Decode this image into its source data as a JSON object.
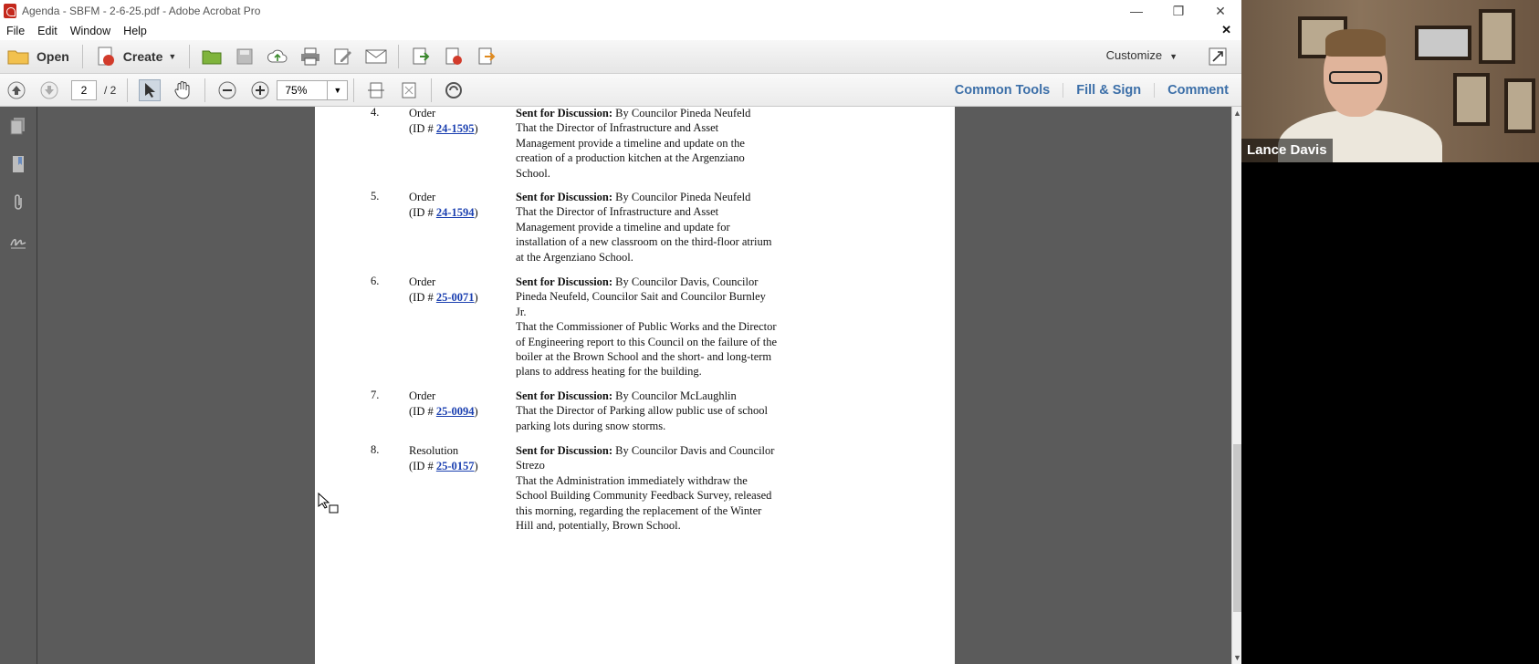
{
  "window": {
    "title": "Agenda - SBFM - 2-6-25.pdf - Adobe Acrobat Pro",
    "controls": {
      "minimize": "—",
      "maximize": "❐",
      "close": "✕"
    }
  },
  "menu": {
    "items": [
      "File",
      "Edit",
      "Window",
      "Help"
    ],
    "close_doc": "✕"
  },
  "toolbar1": {
    "open_label": "Open",
    "create_label": "Create",
    "customize_label": "Customize"
  },
  "toolbar2": {
    "current_page": "2",
    "total_pages": "/ 2",
    "zoom": "75%",
    "panels": [
      "Common Tools",
      "Fill & Sign",
      "Comment"
    ]
  },
  "document": {
    "items": [
      {
        "num": "4.",
        "type": "Order",
        "id_prefix": "(ID # ",
        "id": "24-1595",
        "id_suffix": ")",
        "lead": "Sent for Discussion:",
        "sponsor": " By Councilor Pineda Neufeld",
        "lines": [
          "That the Director of Infrastructure and Asset",
          "Management provide a timeline and update on the",
          "creation of a production kitchen at the Argenziano",
          "School."
        ]
      },
      {
        "num": "5.",
        "type": "Order",
        "id_prefix": "(ID # ",
        "id": "24-1594",
        "id_suffix": ")",
        "lead": "Sent for Discussion:",
        "sponsor": " By Councilor Pineda Neufeld",
        "lines": [
          "That the Director of Infrastructure and Asset",
          "Management provide a timeline and update for",
          "installation of a new classroom on the third-floor atrium",
          "at the Argenziano School."
        ]
      },
      {
        "num": "6.",
        "type": "Order",
        "id_prefix": "(ID # ",
        "id": "25-0071",
        "id_suffix": ")",
        "lead": "Sent for Discussion:",
        "sponsor": " By Councilor Davis, Councilor",
        "lines": [
          "Pineda Neufeld, Councilor Sait and Councilor Burnley",
          "Jr.",
          "That the Commissioner of Public Works and the Director",
          "of Engineering report to this Council on the failure of the",
          "boiler at the Brown School and the short- and long-term",
          "plans to address heating for the building."
        ]
      },
      {
        "num": "7.",
        "type": "Order",
        "id_prefix": "(ID # ",
        "id": "25-0094",
        "id_suffix": ")",
        "lead": "Sent for Discussion:",
        "sponsor": " By Councilor McLaughlin",
        "lines": [
          "That the Director of Parking allow public use of school",
          "parking lots during snow storms."
        ]
      },
      {
        "num": "8.",
        "type": "Resolution",
        "id_prefix": "(ID # ",
        "id": "25-0157",
        "id_suffix": ")",
        "lead": "Sent for Discussion:",
        "sponsor": " By Councilor Davis and Councilor",
        "lines": [
          "Strezo",
          "That the Administration immediately withdraw the",
          "School Building Community Feedback Survey, released",
          "this morning, regarding the replacement of the Winter",
          "Hill and, potentially, Brown School."
        ]
      }
    ]
  },
  "webcam": {
    "participant_name": "Lance Davis"
  },
  "colors": {
    "accent_link": "#3c6fa8",
    "doc_link": "#1a3fb0",
    "doc_background": "#5b5b5b"
  }
}
